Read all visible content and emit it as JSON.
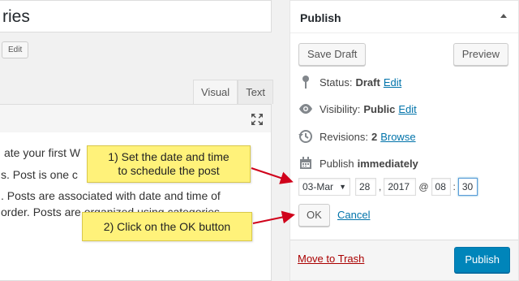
{
  "editor": {
    "title_fragment": "ries",
    "edit_label": "Edit",
    "tabs": [
      {
        "label": "Visual",
        "active": true
      },
      {
        "label": "Text",
        "active": false
      }
    ],
    "content_lines": [
      "ate your first W",
      "s. Post is one c",
      ". Posts are associated with date and time of",
      "order. Posts are organized using categories"
    ]
  },
  "publish": {
    "title": "Publish",
    "save_draft": "Save Draft",
    "preview": "Preview",
    "status_label": "Status:",
    "status_value": "Draft",
    "status_edit": "Edit",
    "visibility_label": "Visibility:",
    "visibility_value": "Public",
    "visibility_edit": "Edit",
    "revisions_label": "Revisions:",
    "revisions_value": "2",
    "revisions_link": "Browse",
    "schedule_label": "Publish",
    "schedule_value": "immediately",
    "date": {
      "month": "03-Mar",
      "day": "28",
      "year": "2017",
      "at": "@",
      "hour": "08",
      "minute": "30"
    },
    "ok_label": "OK",
    "cancel_label": "Cancel",
    "trash_label": "Move to Trash",
    "publish_label": "Publish"
  },
  "callouts": {
    "step1_line1": "1) Set the date and time",
    "step1_line2": "to schedule the post",
    "step2": "2) Click on the OK button"
  },
  "colors": {
    "link": "#0073aa",
    "trash": "#aa0000",
    "primary": "#0085ba",
    "callout": "#fff27a",
    "arrow": "#d0021b"
  },
  "icons": [
    "fullscreen-icon",
    "pin-icon",
    "eye-icon",
    "history-icon",
    "calendar-icon",
    "arrow-up-icon"
  ]
}
